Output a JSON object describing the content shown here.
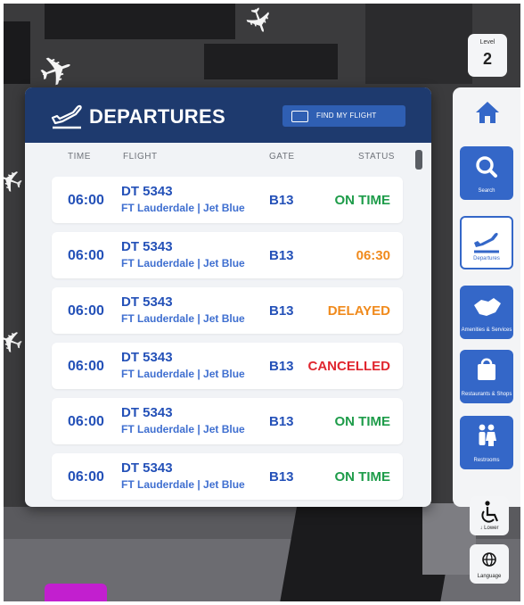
{
  "panel": {
    "title": "DEPARTURES",
    "find_button": "FIND MY FLIGHT",
    "columns": {
      "time": "TIME",
      "flight": "FLIGHT",
      "gate": "GATE",
      "status": "STATUS"
    },
    "rows": [
      {
        "time": "06:00",
        "flight": "DT 5343",
        "route": "FT Lauderdale | Jet Blue",
        "gate": "B13",
        "status": "ON TIME",
        "status_color": "#1e9c4a"
      },
      {
        "time": "06:00",
        "flight": "DT 5343",
        "route": "FT Lauderdale | Jet Blue",
        "gate": "B13",
        "status": "06:30",
        "status_color": "#f08a1c"
      },
      {
        "time": "06:00",
        "flight": "DT 5343",
        "route": "FT Lauderdale | Jet Blue",
        "gate": "B13",
        "status": "DELAYED",
        "status_color": "#f08a1c"
      },
      {
        "time": "06:00",
        "flight": "DT 5343",
        "route": "FT Lauderdale | Jet Blue",
        "gate": "B13",
        "status": "CANCELLED",
        "status_color": "#e0262f"
      },
      {
        "time": "06:00",
        "flight": "DT 5343",
        "route": "FT Lauderdale | Jet Blue",
        "gate": "B13",
        "status": "ON TIME",
        "status_color": "#1e9c4a"
      },
      {
        "time": "06:00",
        "flight": "DT 5343",
        "route": "FT Lauderdale | Jet Blue",
        "gate": "B13",
        "status": "ON TIME",
        "status_color": "#1e9c4a"
      }
    ]
  },
  "level": {
    "label": "Level",
    "value": "2"
  },
  "nav": {
    "home": {
      "icon": "home-icon"
    },
    "items": [
      {
        "label": "Search",
        "icon": "search-icon"
      },
      {
        "label": "Departures",
        "icon": "departures-plane-icon",
        "active": true
      },
      {
        "label": "Amenities & Services",
        "icon": "handshake-icon"
      },
      {
        "label": "Restaurants & Shops",
        "icon": "shopping-bag-icon"
      },
      {
        "label": "Restrooms",
        "icon": "restroom-icon"
      }
    ]
  },
  "bottom": {
    "lower_label": "Lower",
    "language_label": "Language"
  },
  "colors": {
    "header": "#1e3a6e",
    "accent": "#3467c8",
    "text_blue": "#2451b8"
  }
}
